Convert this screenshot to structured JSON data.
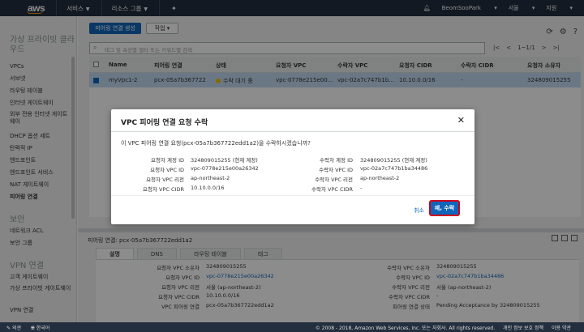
{
  "topnav": {
    "logo": "aws",
    "services": "서비스",
    "resource_groups": "리소스 그룹",
    "user": "BeomSooPark",
    "region": "서울",
    "support": "지원"
  },
  "sidebar": {
    "section_vpc": "가상 프라이빗 클라우드",
    "items_vpc": [
      "VPCs",
      "서브넷",
      "라우팅 테이블",
      "인터넷 게이트웨이",
      "외부 전용 인터넷 게이트웨이",
      "DHCP 옵션 세트",
      "탄력적 IP",
      "엔드포인트",
      "엔드포인트 서비스",
      "NAT 게이트웨이",
      "피어링 연결"
    ],
    "section_security": "보안",
    "items_security": [
      "네트워크 ACL",
      "보안 그룹"
    ],
    "section_vpn": "VPN 연결",
    "items_vpn": [
      "고객 게이트웨이",
      "가상 프라이빗 게이트웨이",
      "VPN 연결"
    ]
  },
  "toolbar": {
    "create_label": "피어링 연결 생성",
    "actions_label": "작업",
    "search_placeholder": "태그 및 속성별 필터 또는 키워드별 검색",
    "pager": "1~1/1"
  },
  "table": {
    "headers": [
      "Name",
      "피어링 연결",
      "상태",
      "요청자 VPC",
      "수락자 VPC",
      "요청자 CIDR",
      "수락자 CIDR",
      "요청자 소유자"
    ],
    "row": [
      "myVpc1-2",
      "pcx-05a7b367722",
      "수락 대기 중",
      "vpc-0778e215e00...",
      "vpc-02a7c747b1b...",
      "10.10.0.0/16",
      "-",
      "324809015255"
    ]
  },
  "modal": {
    "title": "VPC 피어링 연결 요청 수락",
    "question": "이 VPC 피어링 연결 요청(pcx-05a7b367722edd1a2)을 수락하시겠습니까?",
    "left_keys": [
      "요청자 계정 ID",
      "요청자 VPC ID",
      "요청자 VPC 리전",
      "요청자 VPC CIDR"
    ],
    "left_values": [
      "324809015255 (현재 계정)",
      "vpc-0778e215e00a26342",
      "ap-northeast-2",
      "10.10.0.0/16"
    ],
    "right_keys": [
      "수락자 계정 ID",
      "수락자 VPC ID",
      "수락자 VPC 리전",
      "수락자 VPC CIDR"
    ],
    "right_values": [
      "324809015255 (현재 계정)",
      "vpc-02a7c747b1ba34486",
      "ap-northeast-2",
      "-"
    ],
    "cancel": "취소",
    "accept": "예, 수락"
  },
  "detail": {
    "title": "피어링 연결: pcx-05a7b367722edd1a2",
    "tabs": [
      "설명",
      "DNS",
      "라우팅 테이블",
      "태그"
    ],
    "left_keys": [
      "요청자 VPC 소유자",
      "요청자 VPC ID",
      "요청자 VPC 리전",
      "요청자 VPC CIDR",
      "VPC 피어링 연결"
    ],
    "left_values": [
      "324809015255",
      "vpc-0778e215e00a26342",
      "서울 (ap-northeast-2)",
      "10.10.0.0/16",
      "pcx-05a7b367722edd1a2"
    ],
    "right_keys": [
      "수락자 VPC 소유자",
      "수락자 VPC ID",
      "수락자 VPC 리전",
      "수락자 VPC CIDR",
      "피어링 연결 상태"
    ],
    "right_values": [
      "324809015255",
      "vpc-02a7c747b1ba34486",
      "서울 (ap-northeast-2)",
      "-",
      "Pending Acceptance by 324809015255"
    ]
  },
  "footer": {
    "feedback": "의견",
    "language": "한국어",
    "copyright": "© 2008 - 2018, Amazon Web Services, Inc. 또는 자회사. All rights reserved.",
    "privacy": "개인 정보 보호 정책",
    "terms": "이용 약관"
  }
}
